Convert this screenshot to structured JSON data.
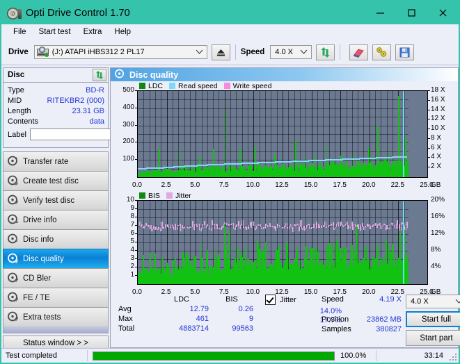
{
  "window": {
    "title": "Opti Drive Control 1.70",
    "icon": "disc-drive-icon",
    "minimize": "minimize-icon",
    "maximize": "maximize-icon",
    "close": "close-icon",
    "titlebar_color": "#35c3ab"
  },
  "menu": {
    "items": [
      {
        "label": "File"
      },
      {
        "label": "Start test"
      },
      {
        "label": "Extra"
      },
      {
        "label": "Help"
      }
    ]
  },
  "toolbar": {
    "drive_label": "Drive",
    "drive_value": "(J:)   ATAPI iHBS312   2 PL17",
    "eject_icon": "eject-icon",
    "speed_label": "Speed",
    "speed_value": "4.0 X",
    "refresh_icon": "refresh-icon",
    "erase_icon": "eraser-icon",
    "tools_icon": "tools-icon",
    "save_icon": "save-icon"
  },
  "disc_panel": {
    "title": "Disc",
    "refresh_icon": "refresh-icon",
    "rows": [
      {
        "key": "Type",
        "value": "BD-R"
      },
      {
        "key": "MID",
        "value": "RITEKBR2 (000)"
      },
      {
        "key": "Length",
        "value": "23.31 GB"
      },
      {
        "key": "Contents",
        "value": "data"
      }
    ],
    "label_key": "Label",
    "label_value": "",
    "label_placeholder": "",
    "disc_button_icon": "disc-icon"
  },
  "sidebar": {
    "items": [
      {
        "label": "Transfer rate",
        "icon": "disc-transfer-icon",
        "active": false
      },
      {
        "label": "Create test disc",
        "icon": "disc-create-icon",
        "active": false
      },
      {
        "label": "Verify test disc",
        "icon": "disc-verify-icon",
        "active": false
      },
      {
        "label": "Drive info",
        "icon": "disc-drive-icon",
        "active": false
      },
      {
        "label": "Disc info",
        "icon": "disc-info-icon",
        "active": false
      },
      {
        "label": "Disc quality",
        "icon": "disc-quality-icon",
        "active": true
      },
      {
        "label": "CD Bler",
        "icon": "disc-bler-icon",
        "active": false
      },
      {
        "label": "FE / TE",
        "icon": "disc-fete-icon",
        "active": false
      },
      {
        "label": "Extra tests",
        "icon": "disc-extra-icon",
        "active": false
      }
    ],
    "status_window_button": "Status window > >"
  },
  "main": {
    "title": "Disc quality",
    "title_icon": "disc-quality-icon"
  },
  "stats": {
    "col_headers": [
      "LDC",
      "BIS"
    ],
    "jitter_label": "Jitter",
    "jitter_checked": true,
    "rows": [
      {
        "key": "Avg",
        "ldc": "12.79",
        "bis": "0.26",
        "jitter": "14.0%"
      },
      {
        "key": "Max",
        "ldc": "461",
        "bis": "9",
        "jitter": "17.7%"
      },
      {
        "key": "Total",
        "ldc": "4883714",
        "bis": "99563",
        "jitter": ""
      }
    ],
    "speed_key": "Speed",
    "speed_value": "4.19 X",
    "position_key": "Position",
    "position_value": "23862 MB",
    "samples_key": "Samples",
    "samples_value": "380827",
    "speed_select": "4.0 X",
    "start_full": "Start full",
    "start_part": "Start part"
  },
  "statusbar": {
    "message": "Test completed",
    "percent_label": "100.0%",
    "percent_value": 100,
    "elapsed": "33:14"
  },
  "chart_data": [
    {
      "id": "ldc-chart",
      "type": "area",
      "title": "",
      "legend": [
        {
          "name": "LDC",
          "color": "#128812"
        },
        {
          "name": "Read speed",
          "color": "#7fd8f8"
        },
        {
          "name": "Write speed",
          "color": "#f78ada"
        }
      ],
      "legend_position": "top-left",
      "xlabel": "GB",
      "xlim": [
        0,
        25
      ],
      "xticks": [
        "0.0",
        "2.5",
        "5.0",
        "7.5",
        "10.0",
        "12.5",
        "15.0",
        "17.5",
        "20.0",
        "22.5",
        "25.0"
      ],
      "ylabel_left": "LDC",
      "ylim": [
        0,
        500
      ],
      "yticks_left": [
        "100",
        "200",
        "300",
        "400",
        "500"
      ],
      "ylabel_right": "Speed",
      "ylim_right": [
        0,
        18
      ],
      "yticks_right": [
        "2 X",
        "4 X",
        "6 X",
        "8 X",
        "10 X",
        "12 X",
        "14 X",
        "16 X",
        "18 X"
      ],
      "grid": true,
      "data_end_gb": 23.4,
      "cursor_gb": 22.9,
      "series": [
        {
          "name": "LDC",
          "color": "#12c212",
          "baseline": [
            30,
            34,
            32,
            36,
            38,
            35,
            40,
            37,
            42,
            39,
            44,
            41,
            38,
            43,
            40,
            45,
            42,
            47,
            44,
            41,
            46,
            43,
            48,
            45,
            50,
            47,
            44,
            49,
            46,
            51,
            48,
            45,
            50,
            47,
            52,
            49,
            46,
            51,
            48,
            53,
            50,
            47,
            52,
            49,
            54,
            51,
            48,
            53,
            50,
            55,
            52,
            49,
            54,
            51,
            56,
            53,
            50,
            55,
            52,
            57,
            54,
            51,
            56,
            53,
            58,
            55,
            52,
            57,
            54,
            59,
            56,
            53,
            58,
            55,
            60,
            57,
            54,
            59,
            56,
            61,
            58,
            55,
            60,
            57,
            62,
            59,
            56,
            61,
            58,
            63,
            60,
            57,
            62,
            59,
            64,
            61,
            58,
            63,
            60,
            65,
            62,
            59,
            64,
            61,
            66,
            63,
            60,
            65,
            62,
            67,
            64,
            61,
            66,
            63,
            68,
            65,
            62,
            67,
            64,
            69,
            66,
            63,
            68,
            65,
            70,
            67,
            64,
            69,
            66,
            71,
            68,
            65,
            70,
            67,
            72,
            69,
            66,
            71,
            68,
            73,
            70,
            67,
            72,
            69,
            74,
            71,
            68,
            73,
            70,
            75,
            72,
            69,
            74,
            71,
            76,
            73,
            70,
            75,
            72,
            77,
            74,
            71,
            76,
            73,
            78,
            75,
            72,
            77,
            74,
            79,
            76,
            73,
            78,
            75,
            80,
            77,
            74,
            79,
            76,
            81,
            78,
            75,
            80,
            77,
            82,
            79,
            76,
            81,
            78,
            83,
            80,
            77,
            82,
            79,
            84,
            81,
            78,
            83,
            80,
            85
          ],
          "spikes": [
            {
              "x": 1.8,
              "y": 170
            },
            {
              "x": 3.6,
              "y": 160
            },
            {
              "x": 5.3,
              "y": 120
            },
            {
              "x": 6.5,
              "y": 165
            },
            {
              "x": 7.55,
              "y": 390
            },
            {
              "x": 8.8,
              "y": 160
            },
            {
              "x": 10.1,
              "y": 178
            },
            {
              "x": 11.8,
              "y": 132
            },
            {
              "x": 13.6,
              "y": 210
            },
            {
              "x": 14.4,
              "y": 118
            },
            {
              "x": 15.3,
              "y": 128
            },
            {
              "x": 16.2,
              "y": 186
            },
            {
              "x": 17.5,
              "y": 125
            },
            {
              "x": 18.6,
              "y": 140
            },
            {
              "x": 19.9,
              "y": 170
            },
            {
              "x": 20.7,
              "y": 300
            },
            {
              "x": 21.6,
              "y": 132
            },
            {
              "x": 22.5,
              "y": 470
            },
            {
              "x": 23.1,
              "y": 230
            }
          ]
        },
        {
          "name": "Read speed",
          "color": "#7fd8f8",
          "points": [
            {
              "x": 0.0,
              "y": 1.9
            },
            {
              "x": 2.0,
              "y": 2.1
            },
            {
              "x": 4.0,
              "y": 2.4
            },
            {
              "x": 6.0,
              "y": 2.7
            },
            {
              "x": 8.0,
              "y": 2.9
            },
            {
              "x": 10.0,
              "y": 3.1
            },
            {
              "x": 12.0,
              "y": 3.3
            },
            {
              "x": 14.0,
              "y": 3.5
            },
            {
              "x": 16.0,
              "y": 3.7
            },
            {
              "x": 18.0,
              "y": 3.9
            },
            {
              "x": 20.0,
              "y": 4.1
            },
            {
              "x": 22.0,
              "y": 4.3
            },
            {
              "x": 23.2,
              "y": 4.4
            }
          ]
        }
      ]
    },
    {
      "id": "bis-jitter-chart",
      "type": "area",
      "title": "",
      "legend": [
        {
          "name": "BIS",
          "color": "#128812"
        },
        {
          "name": "Jitter",
          "color": "#e0a8e0"
        }
      ],
      "legend_position": "top-left",
      "xlabel": "GB",
      "xlim": [
        0,
        25
      ],
      "xticks": [
        "0.0",
        "2.5",
        "5.0",
        "7.5",
        "10.0",
        "12.5",
        "15.0",
        "17.5",
        "20.0",
        "22.5",
        "25.0"
      ],
      "ylabel_left": "BIS",
      "ylim": [
        0,
        10
      ],
      "yticks_left": [
        "1",
        "2",
        "3",
        "4",
        "5",
        "6",
        "7",
        "8",
        "9",
        "10"
      ],
      "ylabel_right": "Jitter",
      "ylim_right": [
        0,
        20
      ],
      "yticks_right": [
        "4%",
        "8%",
        "12%",
        "16%",
        "20%"
      ],
      "grid": true,
      "data_end_gb": 23.4,
      "cursor_gb": 22.9,
      "series": [
        {
          "name": "BIS",
          "color": "#12c212",
          "baseline_low": 2.0,
          "baseline_high": 3.0,
          "transition_gb": 7.3,
          "spikes": [
            {
              "x": 3.2,
              "y": 3.1
            },
            {
              "x": 4.0,
              "y": 3.2
            },
            {
              "x": 5.4,
              "y": 5.1
            },
            {
              "x": 6.0,
              "y": 4.1
            },
            {
              "x": 6.6,
              "y": 4.2
            },
            {
              "x": 7.0,
              "y": 3.6
            },
            {
              "x": 7.45,
              "y": 7.0
            },
            {
              "x": 7.9,
              "y": 6.2
            },
            {
              "x": 8.6,
              "y": 4.4
            },
            {
              "x": 9.3,
              "y": 4.1
            },
            {
              "x": 10.3,
              "y": 5.2
            },
            {
              "x": 11.0,
              "y": 4.3
            },
            {
              "x": 11.9,
              "y": 4.2
            },
            {
              "x": 12.8,
              "y": 5.0
            },
            {
              "x": 13.7,
              "y": 4.3
            },
            {
              "x": 14.5,
              "y": 4.6
            },
            {
              "x": 15.4,
              "y": 4.2
            },
            {
              "x": 16.3,
              "y": 4.5
            },
            {
              "x": 17.2,
              "y": 5.4
            },
            {
              "x": 18.0,
              "y": 4.4
            },
            {
              "x": 18.9,
              "y": 7.0
            },
            {
              "x": 19.8,
              "y": 4.6
            },
            {
              "x": 20.6,
              "y": 4.3
            },
            {
              "x": 21.4,
              "y": 5.4
            },
            {
              "x": 22.0,
              "y": 4.8
            },
            {
              "x": 22.6,
              "y": 6.1
            },
            {
              "x": 23.0,
              "y": 7.3
            }
          ]
        },
        {
          "name": "Jitter",
          "color": "#e0a8e0",
          "mean_percent": 14.0,
          "min_percent": 11.0,
          "max_percent": 17.7
        }
      ]
    }
  ]
}
